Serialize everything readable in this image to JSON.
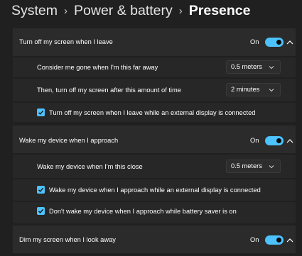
{
  "breadcrumb": {
    "items": [
      "System",
      "Power & battery"
    ],
    "current": "Presence",
    "separator": "›"
  },
  "sections": [
    {
      "title": "Turn off my screen when I leave",
      "state": "On",
      "toggle_on": true,
      "settings": [
        {
          "label": "Consider me gone when I'm this far away",
          "value": "0.5 meters"
        },
        {
          "label": "Then, turn off my screen after this amount of time",
          "value": "2 minutes"
        }
      ],
      "checkbox": {
        "label": "Turn off my screen when I leave while an external display is connected",
        "checked": true
      }
    },
    {
      "title": "Wake my device when I approach",
      "state": "On",
      "toggle_on": true,
      "settings": [
        {
          "label": "Wake my device when I'm this close",
          "value": "0.5 meters"
        }
      ],
      "checkboxes": [
        {
          "label": "Wake my device when I approach while an external display is connected",
          "checked": true
        },
        {
          "label": "Don't wake my device when I approach while battery saver is on",
          "checked": true
        }
      ]
    },
    {
      "title": "Dim my screen when I look away",
      "state": "On",
      "toggle_on": true
    }
  ],
  "colors": {
    "accent": "#4cc2ff",
    "background": "#202020",
    "card": "#2b2b2b"
  }
}
